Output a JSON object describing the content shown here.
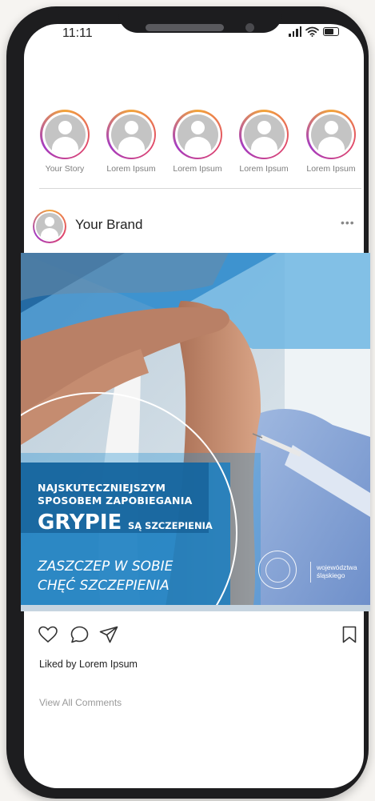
{
  "status_bar": {
    "time": "11:11"
  },
  "stories": [
    {
      "label": "Your Story"
    },
    {
      "label": "Lorem Ipsum"
    },
    {
      "label": "Lorem Ipsum"
    },
    {
      "label": "Lorem Ipsum"
    },
    {
      "label": "Lorem Ipsum"
    }
  ],
  "post": {
    "brand": "Your Brand",
    "more_label": "•••",
    "image": {
      "headline_line1": "NAJSKUTECZNIEJSZYM",
      "headline_line2": "SPOSOBEM ZAPOBIEGANIA",
      "headline_big": "GRYPIE",
      "headline_small": "SĄ SZCZEPIENIA",
      "slogan_line1": "ZASZCZEP W SOBIE",
      "slogan_line2": "CHĘĆ SZCZEPIENIA",
      "org_line1": "województwa",
      "org_line2": "śląskiego"
    },
    "liked_by": "Liked by Lorem Ipsum",
    "view_comments": "View All Comments"
  },
  "icons": {
    "like": "heart-icon",
    "comment": "comment-icon",
    "share": "send-icon",
    "save": "bookmark-icon",
    "signal": "signal-icon",
    "wifi": "wifi-icon",
    "battery": "battery-icon"
  },
  "colors": {
    "story_ring_start": "#f2a53b",
    "story_ring_mid": "#e0456b",
    "story_ring_end": "#a53cc1",
    "poster_blue": "#1e7fc0",
    "avatar_grey": "#c4c4c4"
  }
}
